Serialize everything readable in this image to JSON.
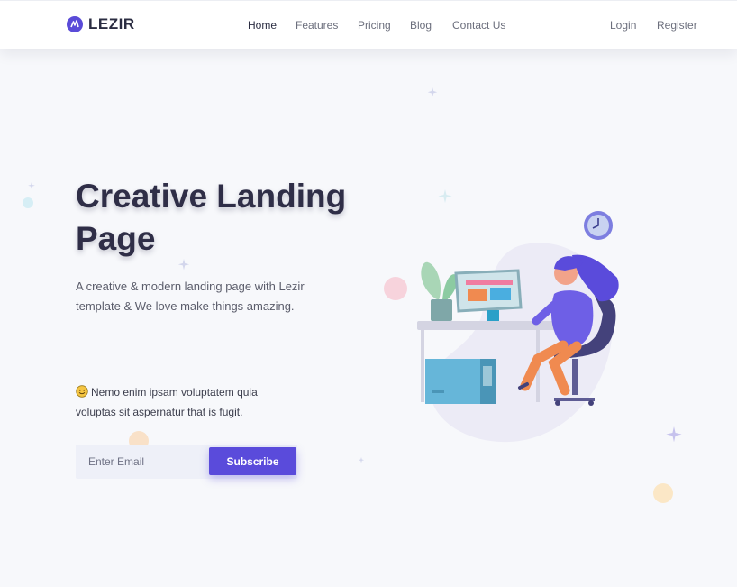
{
  "brand": {
    "name": "LEZIR",
    "logo_icon": "lezir-logo-icon"
  },
  "nav": {
    "links": [
      {
        "label": "Home",
        "active": true
      },
      {
        "label": "Features",
        "active": false
      },
      {
        "label": "Pricing",
        "active": false
      },
      {
        "label": "Blog",
        "active": false
      },
      {
        "label": "Contact Us",
        "active": false
      }
    ],
    "auth": {
      "login": "Login",
      "register": "Register"
    }
  },
  "hero": {
    "title": "Creative Landing Page",
    "subtitle": "A creative & modern landing page with Lezir template & We love make things amazing.",
    "note": "Nemo enim ipsam voluptatem quia voluptas sit aspernatur that is fugit.",
    "note_icon": "smiling-face-emoji-icon"
  },
  "subscribe": {
    "placeholder": "Enter Email",
    "value": "",
    "button_label": "Subscribe"
  },
  "colors": {
    "accent": "#5a4bdb",
    "title": "#2f2e47",
    "background": "#f7f8fb"
  }
}
